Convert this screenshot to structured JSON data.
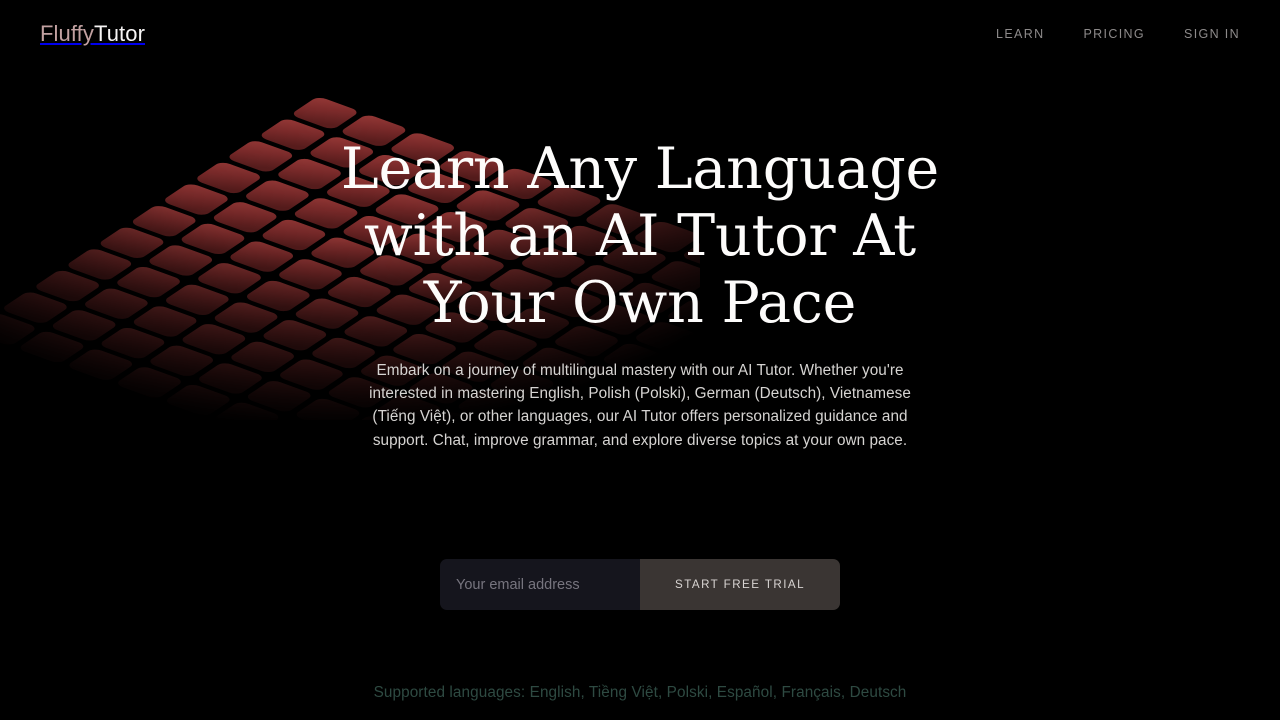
{
  "brand": {
    "name_part_1": "Fluffy",
    "name_part_2": "Tutor",
    "accent_color": "#c2a1a1",
    "background_color": "#000000"
  },
  "nav": {
    "items": [
      {
        "label": "LEARN"
      },
      {
        "label": "PRICING"
      },
      {
        "label": "SIGN IN"
      }
    ]
  },
  "hero": {
    "title": "Learn Any Language with an AI Tutor At Your Own Pace",
    "subtitle": "Embark on a journey of multilingual mastery with our AI Tutor. Whether you're interested in mastering English, Polish (Polski), German (Deutsch), Vietnamese (Tiếng Việt), or other languages, our AI Tutor offers personalized guidance and support. Chat, improve grammar, and explore diverse topics at your own pace."
  },
  "signup": {
    "email_placeholder": "Your email address",
    "email_value": "",
    "cta_label": "START FREE TRIAL",
    "input_background": "#15151d",
    "button_background": "#3a3533"
  },
  "footer": {
    "supported_label": "Supported languages:",
    "supported_list": "English, Tiềng Việt, Polski, Español, Français, Deutsch",
    "supported_color": "#2e4a42"
  },
  "decoration": {
    "grid_name": "perspective-tile-grid",
    "tile_color_bright": "#8f3232",
    "tile_color_dark": "#2b0808",
    "rows": 11,
    "cols": 11
  }
}
